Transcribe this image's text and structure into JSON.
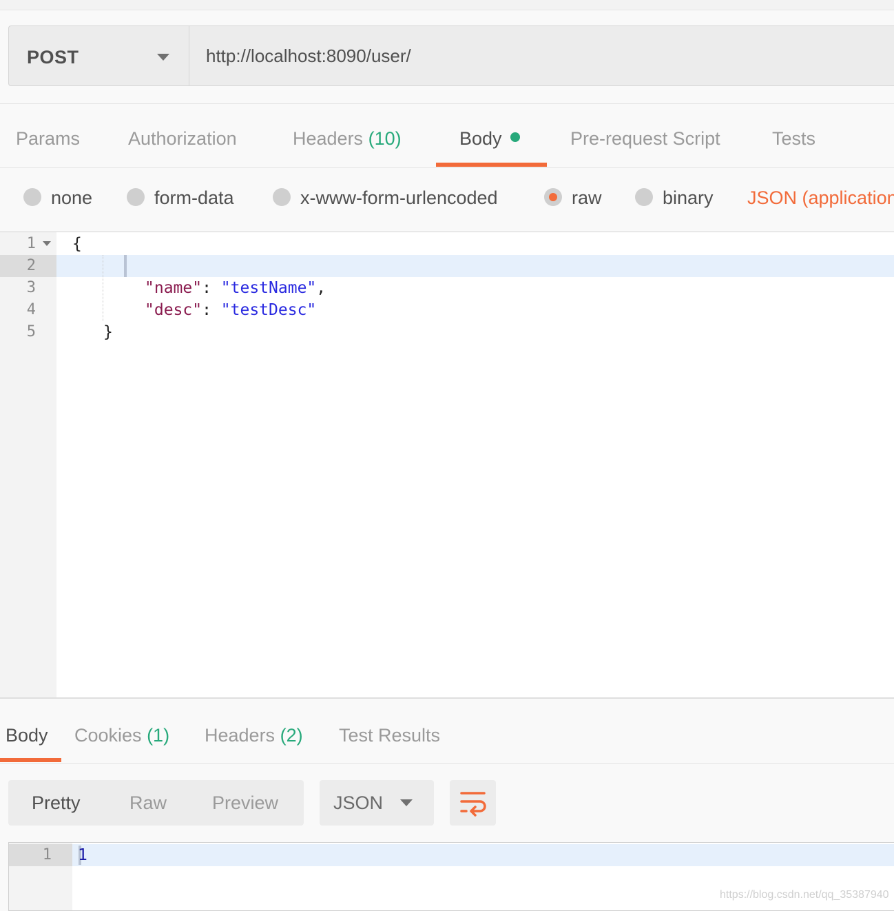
{
  "request": {
    "method": "POST",
    "url": "http://localhost:8090/user/"
  },
  "request_tabs": {
    "params": "Params",
    "authorization": "Authorization",
    "headers_label": "Headers",
    "headers_count": "(10)",
    "body": "Body",
    "prerequest": "Pre-request Script",
    "tests": "Tests"
  },
  "body_types": {
    "none": "none",
    "form_data": "form-data",
    "urlencoded": "x-www-form-urlencoded",
    "raw": "raw",
    "binary": "binary",
    "selected": "raw",
    "content_type": "JSON (application"
  },
  "editor": {
    "line_numbers": [
      "1",
      "2",
      "3",
      "4",
      "5"
    ],
    "line1": "{",
    "key_name": "\"name\"",
    "val_name": "\"testName\"",
    "key_desc": "\"desc\"",
    "val_desc": "\"testDesc\"",
    "colon": ": ",
    "comma": ",",
    "line5": "}"
  },
  "response_tabs": {
    "body": "Body",
    "cookies_label": "Cookies",
    "cookies_count": "(1)",
    "headers_label": "Headers",
    "headers_count": "(2)",
    "test_results": "Test Results"
  },
  "response_toolbar": {
    "pretty": "Pretty",
    "raw": "Raw",
    "preview": "Preview",
    "format": "JSON"
  },
  "response_body": {
    "line_number": "1",
    "content": "1"
  },
  "watermark": "https://blog.csdn.net/qq_35387940",
  "colors": {
    "accent": "#f26b3a",
    "count_green": "#27a97b"
  }
}
